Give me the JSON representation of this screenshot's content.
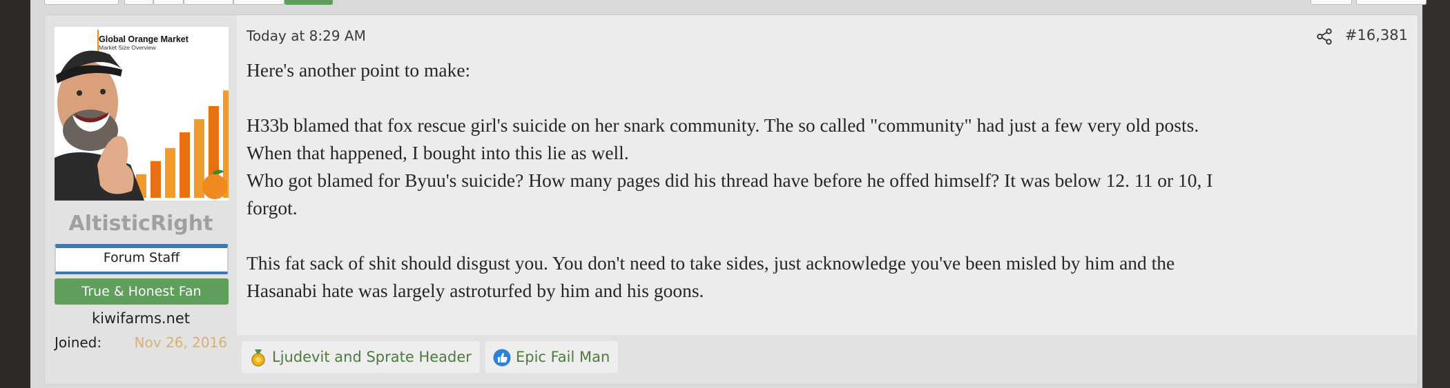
{
  "post": {
    "date": "Today at 8:29 AM",
    "number": "#16,381",
    "share_icon": "share-icon",
    "paragraphs": [
      [
        "Here's another point to make:"
      ],
      [
        "H33b blamed that fox rescue girl's suicide on her snark community. The so called \"community\" had just a few very old posts.",
        "When that happened, I bought into this lie as well.",
        "Who got blamed for Byuu's suicide? How many pages did his thread have before he offed himself? It was below 12. 11 or 10, I",
        "forgot."
      ],
      [
        "This fat sack of shit should disgust you. You don't need to take sides, just acknowledge you've been misled by him and the",
        "Hasanabi hate was largely astroturfed by him and his goons."
      ]
    ]
  },
  "user": {
    "avatar": {
      "title": "Global Orange Market",
      "subtitle": "Market Size Overview",
      "bars": [
        0.18,
        0.28,
        0.38,
        0.5,
        0.6,
        0.7,
        0.82
      ]
    },
    "name": "AltisticRight",
    "banner_staff": "Forum Staff",
    "banner_fan": "True & Honest Fan",
    "site": "kiwifarms.net",
    "joined_label": "Joined:",
    "joined_value": "Nov 26, 2016"
  },
  "reactions": [
    {
      "label": "Ljudevit and Sprate Header",
      "icon": "gold-medal-icon"
    },
    {
      "label": "Epic Fail Man",
      "icon": "thumbs-up-icon"
    }
  ],
  "colors": {
    "username": "#a0a0a0",
    "staff_border": "#3b78b4",
    "fan_banner": "#5f9e5b",
    "joined_value": "#d9b074",
    "reaction_text": "#4c7a3f"
  }
}
